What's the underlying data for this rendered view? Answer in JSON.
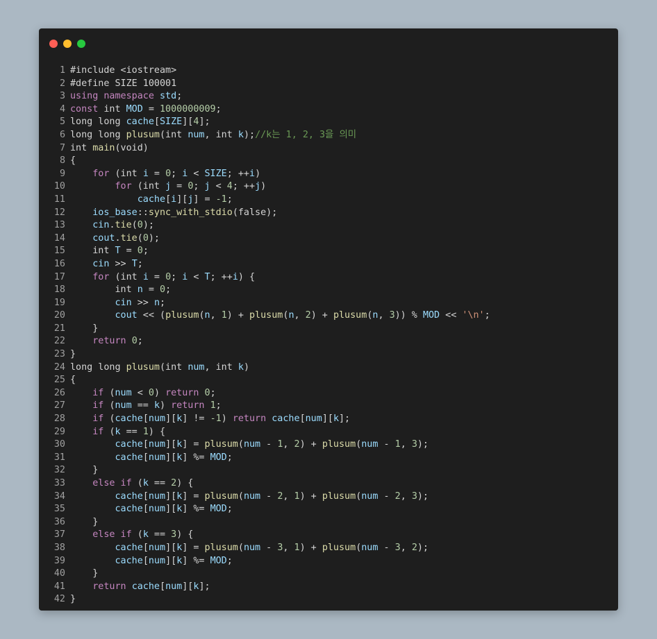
{
  "window": {
    "controls": [
      "close",
      "minimize",
      "maximize"
    ]
  },
  "colors": {
    "background": "#abb8c3",
    "editor": "#1e1e1e",
    "keyword": "#c586c0",
    "variable": "#9cdcfe",
    "function": "#dcdcaa",
    "number": "#b5cea8",
    "string": "#ce9178",
    "comment": "#6a9955"
  },
  "code_lines": [
    [
      [
        "#include <iostream>",
        "p"
      ]
    ],
    [
      [
        "#define SIZE 100001",
        "p"
      ]
    ],
    [
      [
        "using namespace ",
        "k"
      ],
      [
        "std",
        "v"
      ],
      [
        ";",
        "p"
      ]
    ],
    [
      [
        "const ",
        "k"
      ],
      [
        "int ",
        "t"
      ],
      [
        "MOD",
        "v"
      ],
      [
        " = ",
        "p"
      ],
      [
        "1000000009",
        "n"
      ],
      [
        ";",
        "p"
      ]
    ],
    [
      [
        "long long ",
        "t"
      ],
      [
        "cache",
        "v"
      ],
      [
        "[",
        "p"
      ],
      [
        "SIZE",
        "v"
      ],
      [
        "][",
        "p"
      ],
      [
        "4",
        "n"
      ],
      [
        "];",
        "p"
      ]
    ],
    [
      [
        "long long ",
        "t"
      ],
      [
        "plusum",
        "f"
      ],
      [
        "(int ",
        "t"
      ],
      [
        "num",
        "v"
      ],
      [
        ", int ",
        "t"
      ],
      [
        "k",
        "v"
      ],
      [
        ");",
        "p"
      ],
      [
        "//k는 1, 2, 3을 의미",
        "c"
      ]
    ],
    [
      [
        "int ",
        "t"
      ],
      [
        "main",
        "f"
      ],
      [
        "(void)",
        "t"
      ]
    ],
    [
      [
        "{",
        "p"
      ]
    ],
    [
      [
        "    for ",
        "k"
      ],
      [
        "(int ",
        "t"
      ],
      [
        "i",
        "v"
      ],
      [
        " = ",
        "p"
      ],
      [
        "0",
        "n"
      ],
      [
        "; ",
        "p"
      ],
      [
        "i",
        "v"
      ],
      [
        " < ",
        "p"
      ],
      [
        "SIZE",
        "v"
      ],
      [
        "; ++",
        "p"
      ],
      [
        "i",
        "v"
      ],
      [
        ")",
        "p"
      ]
    ],
    [
      [
        "        for ",
        "k"
      ],
      [
        "(int ",
        "t"
      ],
      [
        "j",
        "v"
      ],
      [
        " = ",
        "p"
      ],
      [
        "0",
        "n"
      ],
      [
        "; ",
        "p"
      ],
      [
        "j",
        "v"
      ],
      [
        " < ",
        "p"
      ],
      [
        "4",
        "n"
      ],
      [
        "; ++",
        "p"
      ],
      [
        "j",
        "v"
      ],
      [
        ")",
        "p"
      ]
    ],
    [
      [
        "            cache",
        "v"
      ],
      [
        "[",
        "p"
      ],
      [
        "i",
        "v"
      ],
      [
        "][",
        "p"
      ],
      [
        "j",
        "v"
      ],
      [
        "] = ",
        "p"
      ],
      [
        "-1",
        "n"
      ],
      [
        ";",
        "p"
      ]
    ],
    [
      [
        "    ios_base",
        "v"
      ],
      [
        "::",
        "p"
      ],
      [
        "sync_with_stdio",
        "f"
      ],
      [
        "(false);",
        "t"
      ]
    ],
    [
      [
        "    cin",
        "v"
      ],
      [
        ".",
        "p"
      ],
      [
        "tie",
        "f"
      ],
      [
        "(",
        "p"
      ],
      [
        "0",
        "n"
      ],
      [
        ");",
        "p"
      ]
    ],
    [
      [
        "    cout",
        "v"
      ],
      [
        ".",
        "p"
      ],
      [
        "tie",
        "f"
      ],
      [
        "(",
        "p"
      ],
      [
        "0",
        "n"
      ],
      [
        ");",
        "p"
      ]
    ],
    [
      [
        "    int ",
        "t"
      ],
      [
        "T",
        "v"
      ],
      [
        " = ",
        "p"
      ],
      [
        "0",
        "n"
      ],
      [
        ";",
        "p"
      ]
    ],
    [
      [
        "    cin",
        "v"
      ],
      [
        " >> ",
        "p"
      ],
      [
        "T",
        "v"
      ],
      [
        ";",
        "p"
      ]
    ],
    [
      [
        "    for ",
        "k"
      ],
      [
        "(int ",
        "t"
      ],
      [
        "i",
        "v"
      ],
      [
        " = ",
        "p"
      ],
      [
        "0",
        "n"
      ],
      [
        "; ",
        "p"
      ],
      [
        "i",
        "v"
      ],
      [
        " < ",
        "p"
      ],
      [
        "T",
        "v"
      ],
      [
        "; ++",
        "p"
      ],
      [
        "i",
        "v"
      ],
      [
        ") {",
        "p"
      ]
    ],
    [
      [
        "        int ",
        "t"
      ],
      [
        "n",
        "v"
      ],
      [
        " = ",
        "p"
      ],
      [
        "0",
        "n"
      ],
      [
        ";",
        "p"
      ]
    ],
    [
      [
        "        cin",
        "v"
      ],
      [
        " >> ",
        "p"
      ],
      [
        "n",
        "v"
      ],
      [
        ";",
        "p"
      ]
    ],
    [
      [
        "        cout",
        "v"
      ],
      [
        " << (",
        "p"
      ],
      [
        "plusum",
        "f"
      ],
      [
        "(",
        "p"
      ],
      [
        "n",
        "v"
      ],
      [
        ", ",
        "p"
      ],
      [
        "1",
        "n"
      ],
      [
        ") + ",
        "p"
      ],
      [
        "plusum",
        "f"
      ],
      [
        "(",
        "p"
      ],
      [
        "n",
        "v"
      ],
      [
        ", ",
        "p"
      ],
      [
        "2",
        "n"
      ],
      [
        ") + ",
        "p"
      ],
      [
        "plusum",
        "f"
      ],
      [
        "(",
        "p"
      ],
      [
        "n",
        "v"
      ],
      [
        ", ",
        "p"
      ],
      [
        "3",
        "n"
      ],
      [
        ")) % ",
        "p"
      ],
      [
        "MOD",
        "v"
      ],
      [
        " << ",
        "p"
      ],
      [
        "'\\n'",
        "s"
      ],
      [
        ";",
        "p"
      ]
    ],
    [
      [
        "    }",
        "p"
      ]
    ],
    [
      [
        "    return ",
        "k"
      ],
      [
        "0",
        "n"
      ],
      [
        ";",
        "p"
      ]
    ],
    [
      [
        "}",
        "p"
      ]
    ],
    [
      [
        "long long ",
        "t"
      ],
      [
        "plusum",
        "f"
      ],
      [
        "(int ",
        "t"
      ],
      [
        "num",
        "v"
      ],
      [
        ", int ",
        "t"
      ],
      [
        "k",
        "v"
      ],
      [
        ")",
        "p"
      ]
    ],
    [
      [
        "{",
        "p"
      ]
    ],
    [
      [
        "    if ",
        "k"
      ],
      [
        "(",
        "p"
      ],
      [
        "num",
        "v"
      ],
      [
        " < ",
        "p"
      ],
      [
        "0",
        "n"
      ],
      [
        ") ",
        "p"
      ],
      [
        "return ",
        "k"
      ],
      [
        "0",
        "n"
      ],
      [
        ";",
        "p"
      ]
    ],
    [
      [
        "    if ",
        "k"
      ],
      [
        "(",
        "p"
      ],
      [
        "num",
        "v"
      ],
      [
        " == ",
        "p"
      ],
      [
        "k",
        "v"
      ],
      [
        ") ",
        "p"
      ],
      [
        "return ",
        "k"
      ],
      [
        "1",
        "n"
      ],
      [
        ";",
        "p"
      ]
    ],
    [
      [
        "    if ",
        "k"
      ],
      [
        "(",
        "p"
      ],
      [
        "cache",
        "v"
      ],
      [
        "[",
        "p"
      ],
      [
        "num",
        "v"
      ],
      [
        "][",
        "p"
      ],
      [
        "k",
        "v"
      ],
      [
        "] != ",
        "p"
      ],
      [
        "-1",
        "n"
      ],
      [
        ") ",
        "p"
      ],
      [
        "return ",
        "k"
      ],
      [
        "cache",
        "v"
      ],
      [
        "[",
        "p"
      ],
      [
        "num",
        "v"
      ],
      [
        "][",
        "p"
      ],
      [
        "k",
        "v"
      ],
      [
        "];",
        "p"
      ]
    ],
    [
      [
        "    if ",
        "k"
      ],
      [
        "(",
        "p"
      ],
      [
        "k",
        "v"
      ],
      [
        " == ",
        "p"
      ],
      [
        "1",
        "n"
      ],
      [
        ") {",
        "p"
      ]
    ],
    [
      [
        "        cache",
        "v"
      ],
      [
        "[",
        "p"
      ],
      [
        "num",
        "v"
      ],
      [
        "][",
        "p"
      ],
      [
        "k",
        "v"
      ],
      [
        "] = ",
        "p"
      ],
      [
        "plusum",
        "f"
      ],
      [
        "(",
        "p"
      ],
      [
        "num",
        "v"
      ],
      [
        " - ",
        "p"
      ],
      [
        "1",
        "n"
      ],
      [
        ", ",
        "p"
      ],
      [
        "2",
        "n"
      ],
      [
        ") + ",
        "p"
      ],
      [
        "plusum",
        "f"
      ],
      [
        "(",
        "p"
      ],
      [
        "num",
        "v"
      ],
      [
        " - ",
        "p"
      ],
      [
        "1",
        "n"
      ],
      [
        ", ",
        "p"
      ],
      [
        "3",
        "n"
      ],
      [
        ");",
        "p"
      ]
    ],
    [
      [
        "        cache",
        "v"
      ],
      [
        "[",
        "p"
      ],
      [
        "num",
        "v"
      ],
      [
        "][",
        "p"
      ],
      [
        "k",
        "v"
      ],
      [
        "] %= ",
        "p"
      ],
      [
        "MOD",
        "v"
      ],
      [
        ";",
        "p"
      ]
    ],
    [
      [
        "    }",
        "p"
      ]
    ],
    [
      [
        "    else if ",
        "k"
      ],
      [
        "(",
        "p"
      ],
      [
        "k",
        "v"
      ],
      [
        " == ",
        "p"
      ],
      [
        "2",
        "n"
      ],
      [
        ") {",
        "p"
      ]
    ],
    [
      [
        "        cache",
        "v"
      ],
      [
        "[",
        "p"
      ],
      [
        "num",
        "v"
      ],
      [
        "][",
        "p"
      ],
      [
        "k",
        "v"
      ],
      [
        "] = ",
        "p"
      ],
      [
        "plusum",
        "f"
      ],
      [
        "(",
        "p"
      ],
      [
        "num",
        "v"
      ],
      [
        " - ",
        "p"
      ],
      [
        "2",
        "n"
      ],
      [
        ", ",
        "p"
      ],
      [
        "1",
        "n"
      ],
      [
        ") + ",
        "p"
      ],
      [
        "plusum",
        "f"
      ],
      [
        "(",
        "p"
      ],
      [
        "num",
        "v"
      ],
      [
        " - ",
        "p"
      ],
      [
        "2",
        "n"
      ],
      [
        ", ",
        "p"
      ],
      [
        "3",
        "n"
      ],
      [
        ");",
        "p"
      ]
    ],
    [
      [
        "        cache",
        "v"
      ],
      [
        "[",
        "p"
      ],
      [
        "num",
        "v"
      ],
      [
        "][",
        "p"
      ],
      [
        "k",
        "v"
      ],
      [
        "] %= ",
        "p"
      ],
      [
        "MOD",
        "v"
      ],
      [
        ";",
        "p"
      ]
    ],
    [
      [
        "    }",
        "p"
      ]
    ],
    [
      [
        "    else if ",
        "k"
      ],
      [
        "(",
        "p"
      ],
      [
        "k",
        "v"
      ],
      [
        " == ",
        "p"
      ],
      [
        "3",
        "n"
      ],
      [
        ") {",
        "p"
      ]
    ],
    [
      [
        "        cache",
        "v"
      ],
      [
        "[",
        "p"
      ],
      [
        "num",
        "v"
      ],
      [
        "][",
        "p"
      ],
      [
        "k",
        "v"
      ],
      [
        "] = ",
        "p"
      ],
      [
        "plusum",
        "f"
      ],
      [
        "(",
        "p"
      ],
      [
        "num",
        "v"
      ],
      [
        " - ",
        "p"
      ],
      [
        "3",
        "n"
      ],
      [
        ", ",
        "p"
      ],
      [
        "1",
        "n"
      ],
      [
        ") + ",
        "p"
      ],
      [
        "plusum",
        "f"
      ],
      [
        "(",
        "p"
      ],
      [
        "num",
        "v"
      ],
      [
        " - ",
        "p"
      ],
      [
        "3",
        "n"
      ],
      [
        ", ",
        "p"
      ],
      [
        "2",
        "n"
      ],
      [
        ");",
        "p"
      ]
    ],
    [
      [
        "        cache",
        "v"
      ],
      [
        "[",
        "p"
      ],
      [
        "num",
        "v"
      ],
      [
        "][",
        "p"
      ],
      [
        "k",
        "v"
      ],
      [
        "] %= ",
        "p"
      ],
      [
        "MOD",
        "v"
      ],
      [
        ";",
        "p"
      ]
    ],
    [
      [
        "    }",
        "p"
      ]
    ],
    [
      [
        "    return ",
        "k"
      ],
      [
        "cache",
        "v"
      ],
      [
        "[",
        "p"
      ],
      [
        "num",
        "v"
      ],
      [
        "][",
        "p"
      ],
      [
        "k",
        "v"
      ],
      [
        "];",
        "p"
      ]
    ],
    [
      [
        "}",
        "p"
      ]
    ]
  ]
}
